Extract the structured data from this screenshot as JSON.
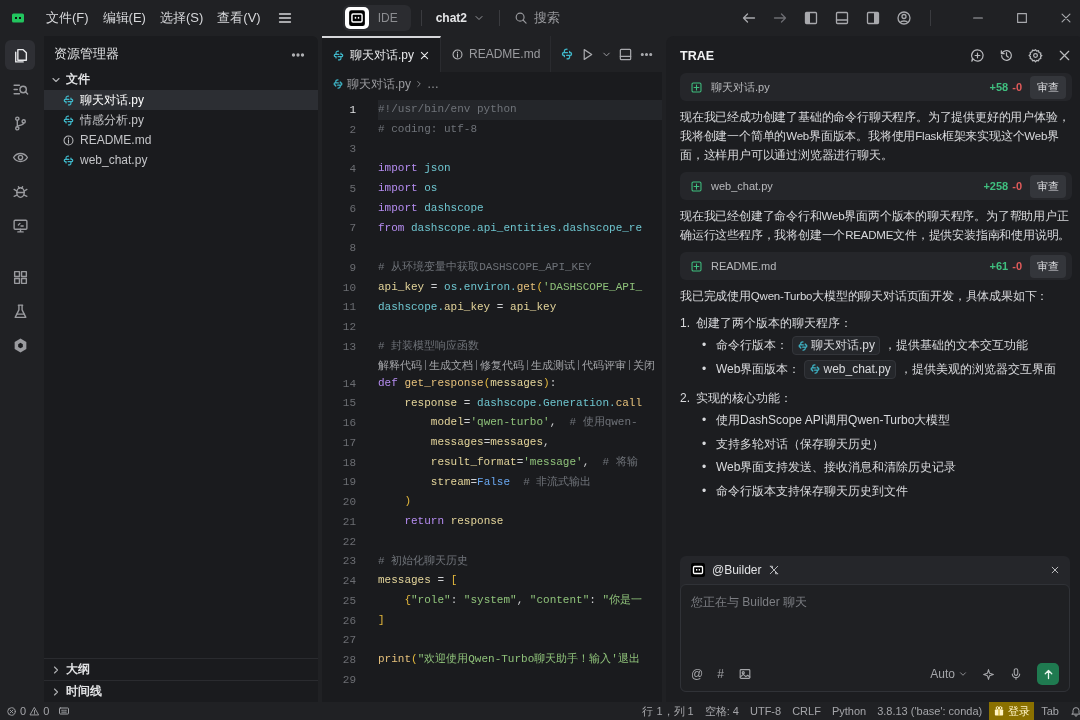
{
  "titlebar": {
    "menus": [
      "文件(F)",
      "编辑(E)",
      "选择(S)",
      "查看(V)"
    ],
    "modes": [
      {
        "selected": true
      },
      {
        "label": "IDE",
        "selected": false
      }
    ],
    "project": "chat2",
    "search": "搜索"
  },
  "activity": [
    {
      "selected": true
    },
    {
      "selected": false
    },
    {
      "selected": false
    },
    {
      "selected": false
    },
    {
      "selected": false
    },
    {
      "selected": false
    },
    {
      "selected": false
    },
    {
      "selected": false
    },
    {
      "selected": false
    }
  ],
  "explorer": {
    "title": "资源管理器",
    "folder": {
      "label": "文件",
      "expanded": true
    },
    "files": [
      {
        "name": "聊天对话.py",
        "kind": "python",
        "selected": true
      },
      {
        "name": "情感分析.py",
        "kind": "python",
        "selected": false
      },
      {
        "name": "README.md",
        "kind": "info",
        "selected": false
      },
      {
        "name": "web_chat.py",
        "kind": "python",
        "selected": false
      }
    ],
    "sections": [
      {
        "label": "大纲",
        "expanded": false
      },
      {
        "label": "时间线",
        "expanded": false
      }
    ]
  },
  "editor": {
    "tabs": [
      {
        "name": "聊天对话.py",
        "kind": "python",
        "selected": true
      },
      {
        "name": "README.md",
        "kind": "info",
        "selected": false
      }
    ],
    "breadcrumb": [
      "聊天对话.py",
      "…"
    ],
    "lines": [
      {
        "kind": "code",
        "number": "1",
        "active": true,
        "tokens": [
          {
            "kind": "cmt",
            "text": "#!/usr/bin/env python"
          }
        ]
      },
      {
        "kind": "code",
        "number": "2",
        "active": false,
        "tokens": [
          {
            "kind": "cmt",
            "text": "# coding: utf-8"
          }
        ]
      },
      {
        "kind": "code",
        "number": "3",
        "active": false
      },
      {
        "kind": "code",
        "number": "4",
        "active": false,
        "tokens": [
          {
            "kind": "kw",
            "text": "import "
          },
          {
            "kind": "mod",
            "text": "json"
          }
        ]
      },
      {
        "kind": "code",
        "number": "5",
        "active": false,
        "tokens": [
          {
            "kind": "kw",
            "text": "import "
          },
          {
            "kind": "mod",
            "text": "os"
          }
        ]
      },
      {
        "kind": "code",
        "number": "6",
        "active": false,
        "tokens": [
          {
            "kind": "kw",
            "text": "import "
          },
          {
            "kind": "mod",
            "text": "dashscope"
          }
        ]
      },
      {
        "kind": "code",
        "number": "7",
        "active": false,
        "tokens": [
          {
            "kind": "kw",
            "text": "from "
          },
          {
            "kind": "mod",
            "text": "dashscope.api_entities.dashscope_re"
          }
        ]
      },
      {
        "kind": "code",
        "number": "8",
        "active": false
      },
      {
        "kind": "code",
        "number": "9",
        "active": false,
        "tokens": [
          {
            "kind": "cmt",
            "text": "# 从环境变量中获取DASHSCOPE_API_KEY"
          }
        ]
      },
      {
        "kind": "code",
        "number": "10",
        "active": false,
        "tokens": [
          {
            "kind": "var",
            "text": "api_key"
          },
          {
            "kind": "p",
            "text": " = "
          },
          {
            "kind": "mod",
            "text": "os.environ."
          },
          {
            "kind": "fn",
            "text": "get"
          },
          {
            "kind": "paren",
            "text": "("
          },
          {
            "kind": "str",
            "text": "'DASHSCOPE_API_"
          }
        ]
      },
      {
        "kind": "code",
        "number": "11",
        "active": false,
        "tokens": [
          {
            "kind": "mod",
            "text": "dashscope."
          },
          {
            "kind": "var",
            "text": "api_key"
          },
          {
            "kind": "p",
            "text": " = "
          },
          {
            "kind": "var",
            "text": "api_key"
          }
        ]
      },
      {
        "kind": "code",
        "number": "12",
        "active": false
      },
      {
        "kind": "code",
        "number": "13",
        "active": false,
        "tokens": [
          {
            "kind": "cmt",
            "text": "# 封装模型响应函数"
          }
        ]
      },
      {
        "kind": "lens",
        "actions": [
          "解释代码",
          "生成文档",
          "修复代码",
          "生成测试",
          "代码评审",
          "关闭"
        ]
      },
      {
        "kind": "code",
        "number": "14",
        "active": false,
        "tokens": [
          {
            "kind": "kw",
            "text": "def "
          },
          {
            "kind": "fn",
            "text": "get_response"
          },
          {
            "kind": "paren",
            "text": "("
          },
          {
            "kind": "var",
            "text": "messages"
          },
          {
            "kind": "paren",
            "text": ")"
          },
          {
            "kind": "p",
            "text": ":"
          }
        ]
      },
      {
        "kind": "code",
        "number": "15",
        "active": false,
        "tokens": [
          {
            "kind": "var",
            "text": "    response"
          },
          {
            "kind": "p",
            "text": " = "
          },
          {
            "kind": "mod",
            "text": "dashscope.Generation."
          },
          {
            "kind": "fn",
            "text": "call"
          }
        ]
      },
      {
        "kind": "code",
        "number": "16",
        "active": false,
        "tokens": [
          {
            "kind": "var",
            "text": "        model"
          },
          {
            "kind": "p",
            "text": "="
          },
          {
            "kind": "str",
            "text": "'qwen-turbo'"
          },
          {
            "kind": "p",
            "text": ",  "
          },
          {
            "kind": "cmt",
            "text": "# 使用qwen-"
          }
        ]
      },
      {
        "kind": "code",
        "number": "17",
        "active": false,
        "tokens": [
          {
            "kind": "var",
            "text": "        messages"
          },
          {
            "kind": "p",
            "text": "="
          },
          {
            "kind": "var",
            "text": "messages"
          },
          {
            "kind": "p",
            "text": ","
          }
        ]
      },
      {
        "kind": "code",
        "number": "18",
        "active": false,
        "tokens": [
          {
            "kind": "var",
            "text": "        result_format"
          },
          {
            "kind": "p",
            "text": "="
          },
          {
            "kind": "str",
            "text": "'message'"
          },
          {
            "kind": "p",
            "text": ",  "
          },
          {
            "kind": "cmt",
            "text": "# 将输"
          }
        ]
      },
      {
        "kind": "code",
        "number": "19",
        "active": false,
        "tokens": [
          {
            "kind": "var",
            "text": "        stream"
          },
          {
            "kind": "p",
            "text": "="
          },
          {
            "kind": "const",
            "text": "False"
          },
          {
            "kind": "cmt",
            "text": "  # 非流式输出"
          }
        ]
      },
      {
        "kind": "code",
        "number": "20",
        "active": false,
        "tokens": [
          {
            "kind": "paren",
            "text": "    )"
          }
        ]
      },
      {
        "kind": "code",
        "number": "21",
        "active": false,
        "tokens": [
          {
            "kind": "kw",
            "text": "    return "
          },
          {
            "kind": "var",
            "text": "response"
          }
        ]
      },
      {
        "kind": "code",
        "number": "22",
        "active": false
      },
      {
        "kind": "code",
        "number": "23",
        "active": false,
        "tokens": [
          {
            "kind": "cmt",
            "text": "# 初始化聊天历史"
          }
        ]
      },
      {
        "kind": "code",
        "number": "24",
        "active": false,
        "tokens": [
          {
            "kind": "var",
            "text": "messages"
          },
          {
            "kind": "p",
            "text": " = "
          },
          {
            "kind": "paren",
            "text": "["
          }
        ]
      },
      {
        "kind": "code",
        "number": "25",
        "active": false,
        "tokens": [
          {
            "kind": "paren",
            "text": "    {"
          },
          {
            "kind": "str",
            "text": "\"role\""
          },
          {
            "kind": "p",
            "text": ": "
          },
          {
            "kind": "str",
            "text": "\"system\""
          },
          {
            "kind": "p",
            "text": ", "
          },
          {
            "kind": "str",
            "text": "\"content\""
          },
          {
            "kind": "p",
            "text": ": "
          },
          {
            "kind": "str",
            "text": "\"你是一"
          }
        ]
      },
      {
        "kind": "code",
        "number": "26",
        "active": false,
        "tokens": [
          {
            "kind": "paren",
            "text": "]"
          }
        ]
      },
      {
        "kind": "code",
        "number": "27",
        "active": false
      },
      {
        "kind": "code",
        "number": "28",
        "active": false,
        "tokens": [
          {
            "kind": "fn",
            "text": "print"
          },
          {
            "kind": "paren",
            "text": "("
          },
          {
            "kind": "str",
            "text": "\"欢迎使用Qwen-Turbo聊天助手！输入'退出"
          }
        ]
      },
      {
        "kind": "code",
        "number": "29",
        "active": false
      }
    ]
  },
  "chat": {
    "title": "TRAE",
    "feed": [
      {
        "kind": "change",
        "file": "聊天对话.py",
        "added": "+58",
        "removed": "-0",
        "action": "审查"
      },
      {
        "kind": "text",
        "text": "现在我已经成功创建了基础的命令行聊天程序。为了提供更好的用户体验，我将创建一个简单的Web界面版本。我将使用Flask框架来实现这个Web界面，这样用户可以通过浏览器进行聊天。"
      },
      {
        "kind": "change",
        "file": "web_chat.py",
        "added": "+258",
        "removed": "-0",
        "action": "审查"
      },
      {
        "kind": "text",
        "text": "现在我已经创建了命令行和Web界面两个版本的聊天程序。为了帮助用户正确运行这些程序，我将创建一个README文件，提供安装指南和使用说明。"
      },
      {
        "kind": "change",
        "file": "README.md",
        "added": "+61",
        "removed": "-0",
        "action": "审查"
      },
      {
        "kind": "text",
        "text": "我已完成使用Qwen-Turbo大模型的聊天对话页面开发，具体成果如下："
      },
      {
        "kind": "list",
        "number": "1.",
        "title": "创建了两个版本的聊天程序：",
        "bullets": [
          {
            "marker": "•",
            "label": "命令行版本：",
            "file": "聊天对话.py",
            "rest": "，提供基础的文本交互功能"
          },
          {
            "marker": "•",
            "label": "Web界面版本：",
            "file": "web_chat.py",
            "rest": "，提供美观的浏览器交互界面"
          }
        ]
      },
      {
        "kind": "list",
        "number": "2.",
        "title": "实现的核心功能：",
        "bullets": [
          {
            "marker": "•",
            "label": "使用DashScope API调用Qwen-Turbo大模型"
          },
          {
            "marker": "•",
            "label": "支持多轮对话（保存聊天历史）"
          },
          {
            "marker": "•",
            "label": "Web界面支持发送、接收消息和清除历史记录"
          },
          {
            "marker": "•",
            "label": "命令行版本支持保存聊天历史到文件"
          }
        ]
      }
    ],
    "input": {
      "agent": "@Builder",
      "placeholder": "您正在与 Builder 聊天",
      "tools": [
        "@",
        "#"
      ],
      "model": "Auto"
    }
  },
  "status": {
    "errors": "0",
    "warnings": "0",
    "items": [
      "行 1，列 1",
      "空格: 4",
      "UTF-8",
      "CRLF",
      "Python",
      "3.8.13 ('base': conda)"
    ],
    "login": "登录",
    "indent": "Tab"
  }
}
